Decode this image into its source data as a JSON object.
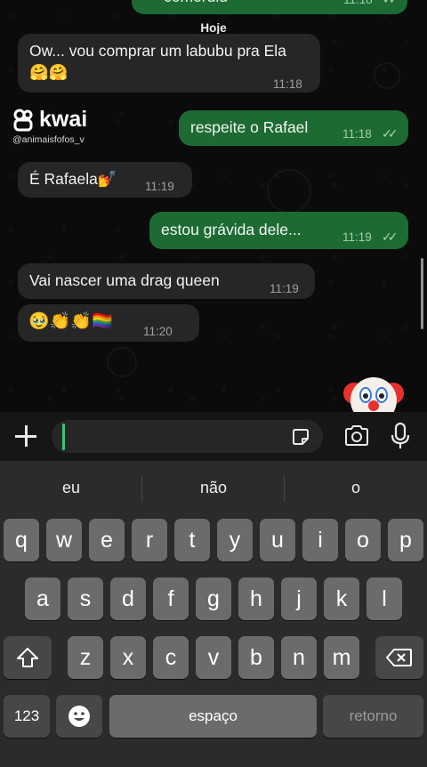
{
  "chat": {
    "date_chip": "Hoje",
    "messages": [
      {
        "id": 1,
        "side": "in",
        "text": "Ow... vou comprar um labubu pra Ela🤗🤗",
        "time": "11:18"
      },
      {
        "id": 2,
        "side": "out",
        "text": "respeite o Rafael",
        "time": "11:18",
        "ticks": "✓✓"
      },
      {
        "id": 3,
        "side": "in",
        "text": "É Rafaela💅",
        "time": "11:19"
      },
      {
        "id": 4,
        "side": "out",
        "text": "estou grávida dele...",
        "time": "11:19",
        "ticks": "✓✓"
      },
      {
        "id": 5,
        "side": "in",
        "text": "Vai nascer uma drag queen",
        "time": "11:19"
      },
      {
        "id": 6,
        "side": "in",
        "text": "🥹👏👏🏳️‍🌈",
        "time": "11:20"
      }
    ],
    "top_partial": {
      "text": "comoruiu",
      "time": "11:18",
      "ticks": "✓✓"
    }
  },
  "watermark": {
    "brand": "kwai",
    "handle": "@animaisfofos_v"
  },
  "reaction_emoji": "🤡",
  "composer": {
    "plus_icon": "plus-icon",
    "input_value": "",
    "sticker_icon": "sticker-icon",
    "camera_icon": "camera-icon",
    "mic_icon": "microphone-icon"
  },
  "keyboard": {
    "suggestions": [
      "eu",
      "não",
      "o"
    ],
    "row1": [
      "q",
      "w",
      "e",
      "r",
      "t",
      "y",
      "u",
      "i",
      "o",
      "p"
    ],
    "row2": [
      "a",
      "s",
      "d",
      "f",
      "g",
      "h",
      "j",
      "k",
      "l"
    ],
    "row3": [
      "z",
      "x",
      "c",
      "v",
      "b",
      "n",
      "m"
    ],
    "numbers_key": "123",
    "space_key": "espaço",
    "return_key": "retorno"
  },
  "colors": {
    "outgoing_bubble": "#1d6b33",
    "incoming_bubble": "#262626",
    "caret": "#25d366"
  }
}
